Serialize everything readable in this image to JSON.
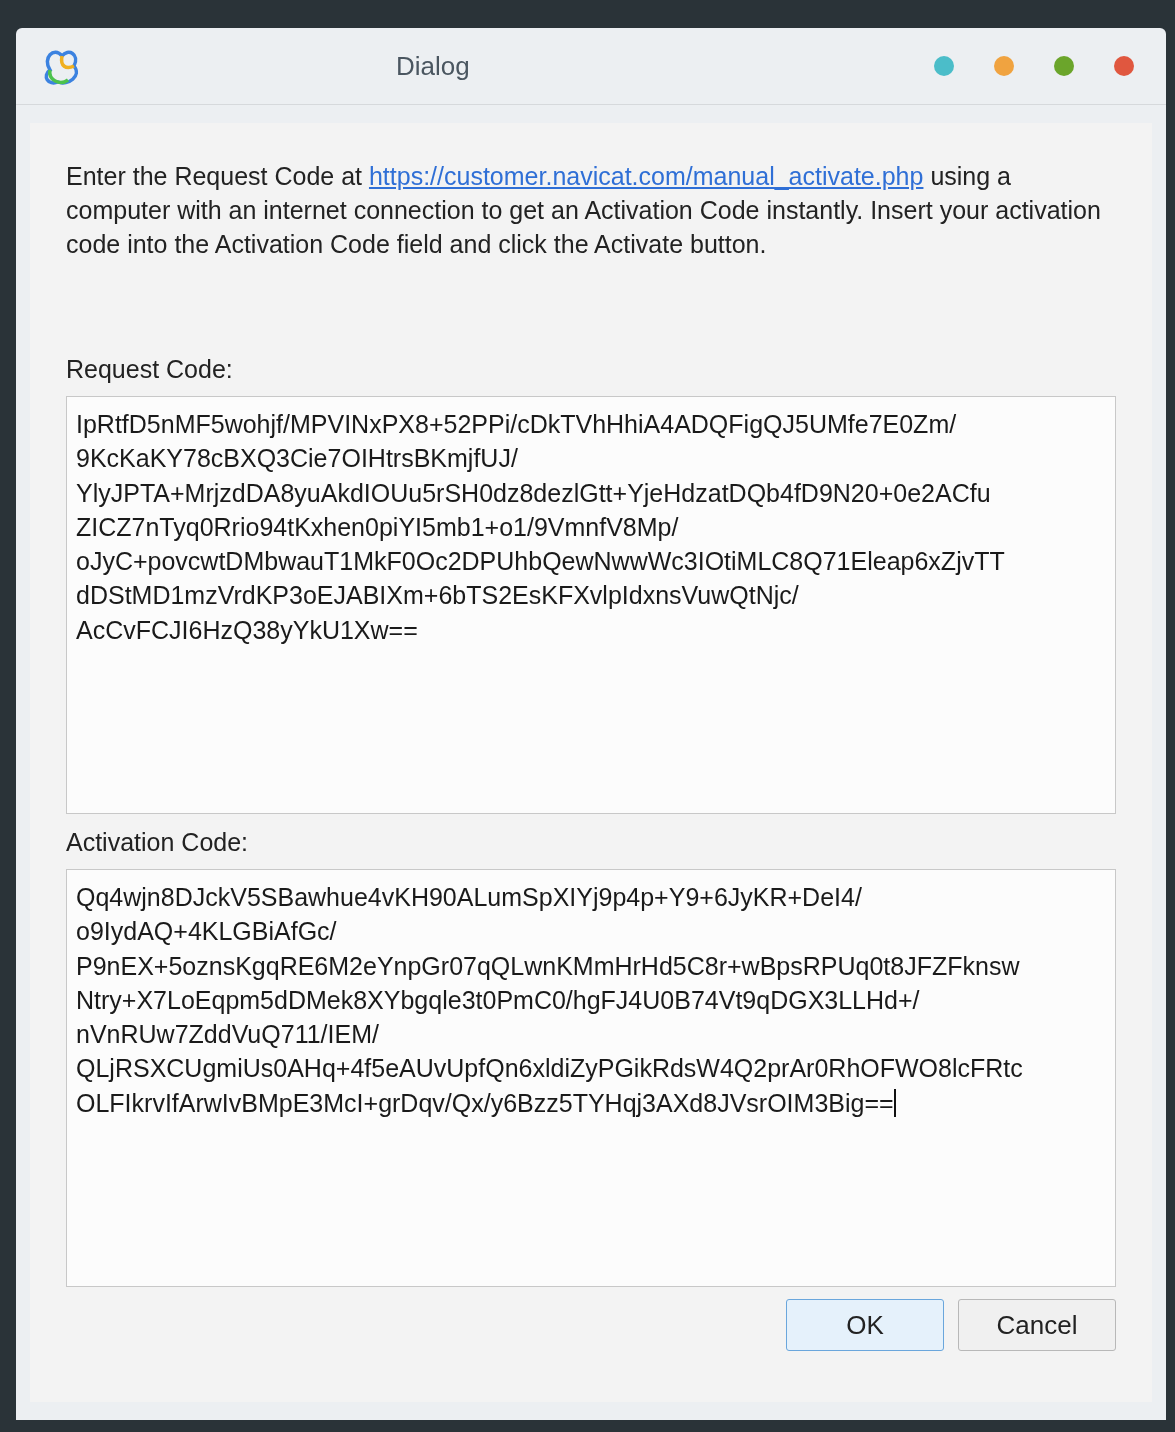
{
  "window": {
    "title": "Dialog",
    "controls": [
      {
        "color": "#4bbdc9"
      },
      {
        "color": "#f0a340"
      },
      {
        "color": "#6ba52b"
      },
      {
        "color": "#e0573f"
      }
    ]
  },
  "instructions": {
    "before": "Enter the Request Code at ",
    "link": "https://customer.navicat.com/manual_activate.php",
    "after": " using a computer with an internet connection to get an Activation Code instantly. Insert your activation code into the Activation Code field and click the Activate button."
  },
  "request_code": {
    "label": "Request Code:",
    "lines": [
      "IpRtfD5nMF5wohjf/MPVINxPX8+52PPi/cDkTVhHhiA4ADQFigQJ5UMfe7E0Zm/",
      "9KcKaKY78cBXQ3Cie7OIHtrsBKmjfUJ/",
      "YlyJPTA+MrjzdDA8yuAkdIOUu5rSH0dz8dezlGtt+YjeHdzatDQb4fD9N20+0e2ACfu",
      "ZICZ7nTyq0Rrio94tKxhen0piYI5mb1+o1/9VmnfV8Mp/",
      "oJyC+povcwtDMbwauT1MkF0Oc2DPUhbQewNwwWc3IOtiMLC8Q71Eleap6xZjvTT",
      "dDStMD1mzVrdKP3oEJABIXm+6bTS2EsKFXvlpIdxnsVuwQtNjc/",
      "AcCvFCJI6HzQ38yYkU1Xw=="
    ]
  },
  "activation_code": {
    "label": "Activation Code:",
    "lines": [
      "Qq4wjn8DJckV5SBawhue4vKH90ALumSpXIYj9p4p+Y9+6JyKR+DeI4/",
      "o9IydAQ+4KLGBiAfGc/",
      "P9nEX+5oznsKgqRE6M2eYnpGr07qQLwnKMmHrHd5C8r+wBpsRPUq0t8JFZFknsw",
      "Ntry+X7LoEqpm5dDMek8XYbgqle3t0PmC0/hgFJ4U0B74Vt9qDGX3LLHd+/",
      "nVnRUw7ZddVuQ711/IEM/",
      "QLjRSXCUgmiUs0AHq+4f5eAUvUpfQn6xldiZyPGikRdsW4Q2prAr0RhOFWO8lcFRtc",
      "OLFIkrvIfArwIvBMpE3McI+grDqv/Qx/y6Bzz5TYHqj3AXd8JVsrOIM3Big=="
    ],
    "focused": true
  },
  "buttons": [
    {
      "label": "OK",
      "kind": "default"
    },
    {
      "label": "Cancel",
      "kind": "normal"
    }
  ]
}
